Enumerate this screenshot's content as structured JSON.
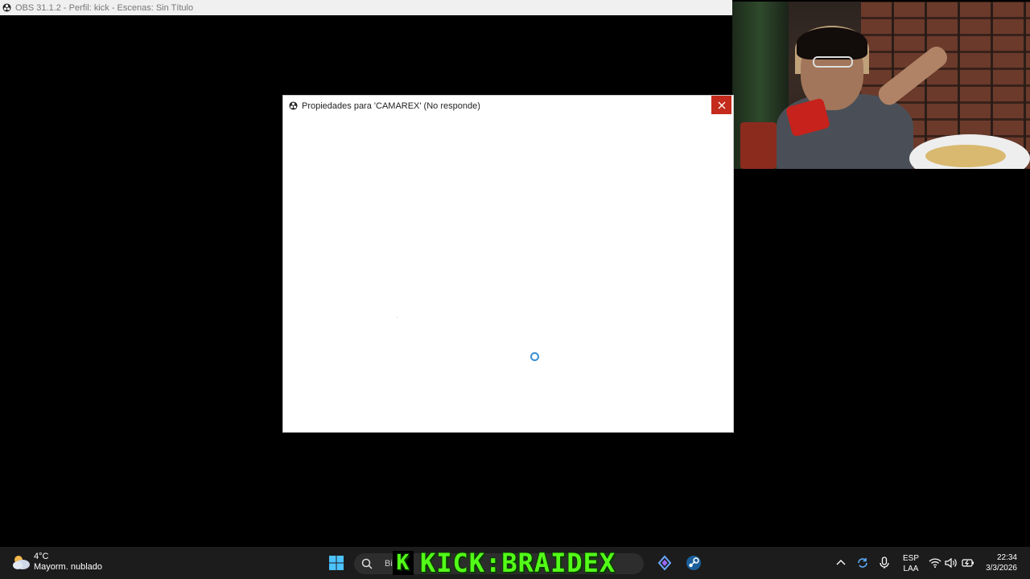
{
  "obs_window": {
    "title": "OBS 31.1.2 - Perfil: kick - Escenas: Sin Título"
  },
  "dialog": {
    "title": "Propiedades para 'CAMAREX' (No responde)",
    "close_label": "✕"
  },
  "taskbar": {
    "weather_temp": "4°C",
    "weather_desc": "Mayorm. nublado",
    "search_text": "Bi",
    "overlay_badge": "K",
    "overlay_text": "KICK:BRAIDEX",
    "lang_primary": "ESP",
    "lang_secondary": "LAA",
    "time": "22:34",
    "date": "3/3/2026"
  },
  "colors": {
    "close_button": "#c42b1c",
    "overlay_green": "#53fc18",
    "taskbar_bg": "#1c1c1c"
  }
}
